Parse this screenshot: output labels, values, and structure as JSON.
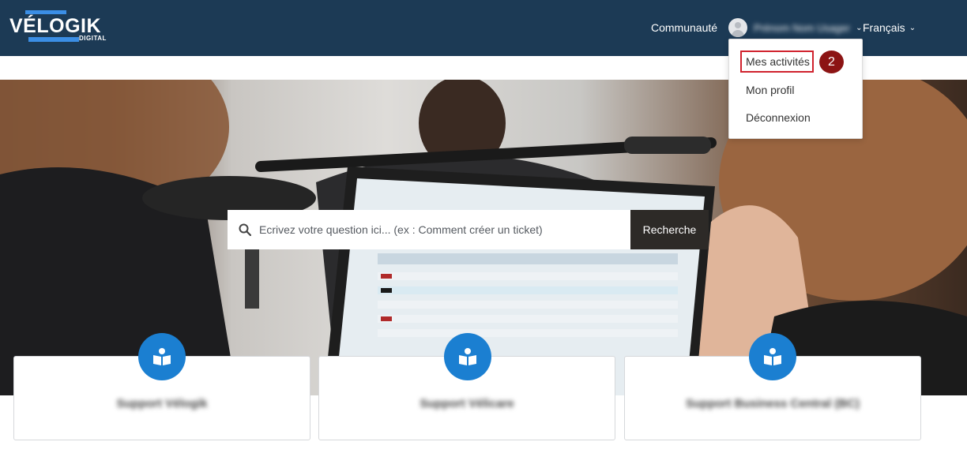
{
  "header": {
    "logo_text": "VÉLOGIK",
    "logo_sub": "DIGITAL",
    "community_link": "Communauté",
    "user_name": "Prénom Nom Usager",
    "language": "Français"
  },
  "user_dropdown": {
    "items": [
      {
        "label": "Mes activités"
      },
      {
        "label": "Mon profil"
      },
      {
        "label": "Déconnexion"
      }
    ],
    "step_badge": "2"
  },
  "search": {
    "placeholder": "Ecrivez votre question ici... (ex : Comment créer un ticket)",
    "button_label": "Recherche"
  },
  "cards": [
    {
      "title": "Support Vélogik"
    },
    {
      "title": "Support Vélicare"
    },
    {
      "title": "Support Business Central (BC)"
    }
  ],
  "colors": {
    "header_bg": "#1c3a55",
    "accent": "#1b7fd1",
    "highlight_border": "#d0222d",
    "badge_bg": "#8c1414"
  }
}
